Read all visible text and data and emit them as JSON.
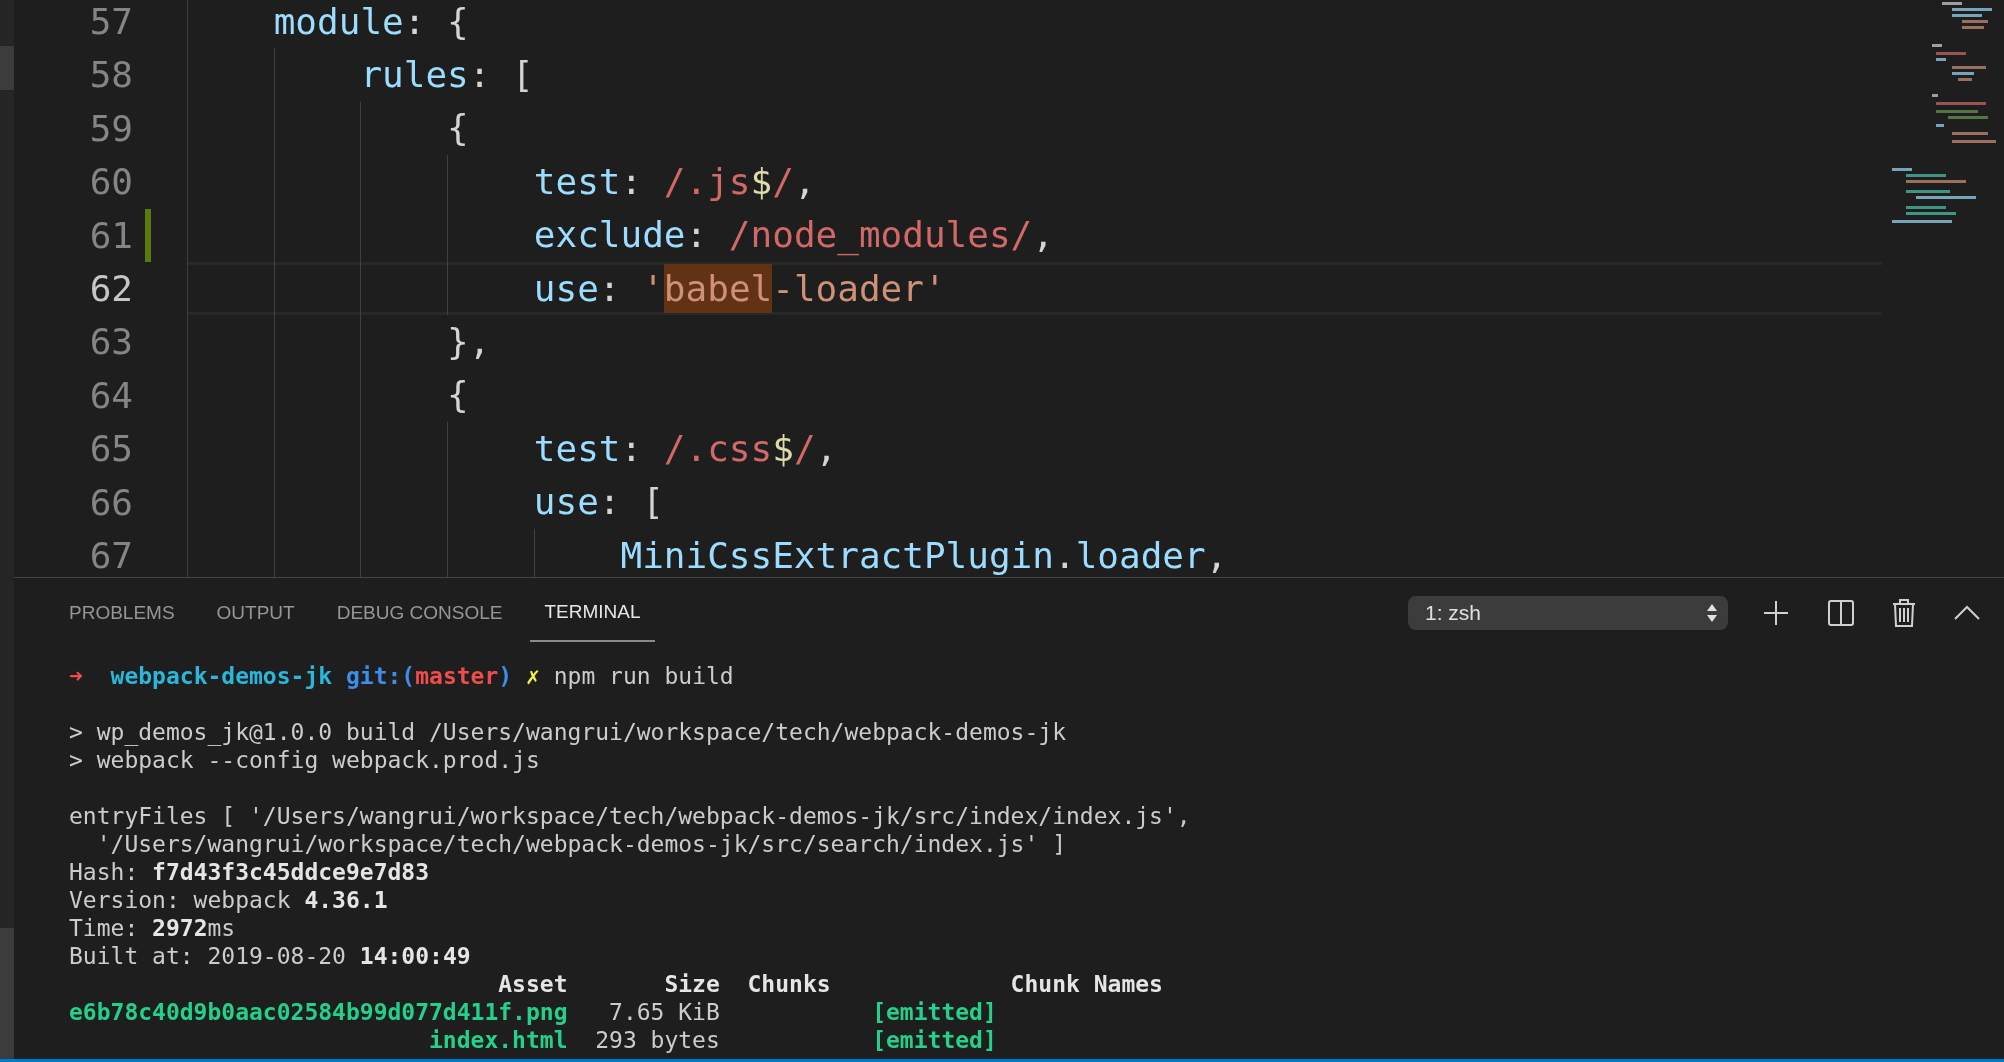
{
  "editor": {
    "lines": [
      {
        "number": "57",
        "current": false,
        "modified": false,
        "tokens": [
          {
            "text": "    module",
            "kind": "key"
          },
          {
            "text": ": {",
            "kind": "punct"
          }
        ]
      },
      {
        "number": "58",
        "current": false,
        "modified": false,
        "tokens": [
          {
            "text": "        rules",
            "kind": "key"
          },
          {
            "text": ": [",
            "kind": "punct"
          }
        ]
      },
      {
        "number": "59",
        "current": false,
        "modified": false,
        "tokens": [
          {
            "text": "            {",
            "kind": "punct"
          }
        ]
      },
      {
        "number": "60",
        "current": false,
        "modified": false,
        "tokens": [
          {
            "text": "                test",
            "kind": "key"
          },
          {
            "text": ": ",
            "kind": "punct"
          },
          {
            "text": "/.js",
            "kind": "regex"
          },
          {
            "text": "$",
            "kind": "dollar"
          },
          {
            "text": "/",
            "kind": "regex"
          },
          {
            "text": ",",
            "kind": "punct"
          }
        ]
      },
      {
        "number": "61",
        "current": false,
        "modified": true,
        "tokens": [
          {
            "text": "                exclude",
            "kind": "key"
          },
          {
            "text": ": ",
            "kind": "punct"
          },
          {
            "text": "/node_modules/",
            "kind": "regex"
          },
          {
            "text": ",",
            "kind": "punct"
          }
        ]
      },
      {
        "number": "62",
        "current": true,
        "modified": false,
        "tokens": [
          {
            "text": "                use",
            "kind": "key"
          },
          {
            "text": ": ",
            "kind": "punct"
          },
          {
            "text": "'",
            "kind": "string"
          },
          {
            "text": "babel",
            "kind": "match"
          },
          {
            "text": "-loader'",
            "kind": "string"
          }
        ]
      },
      {
        "number": "63",
        "current": false,
        "modified": false,
        "tokens": [
          {
            "text": "            },",
            "kind": "punct"
          }
        ]
      },
      {
        "number": "64",
        "current": false,
        "modified": false,
        "tokens": [
          {
            "text": "            {",
            "kind": "punct"
          }
        ]
      },
      {
        "number": "65",
        "current": false,
        "modified": false,
        "tokens": [
          {
            "text": "                test",
            "kind": "key"
          },
          {
            "text": ": ",
            "kind": "punct"
          },
          {
            "text": "/.css",
            "kind": "regex"
          },
          {
            "text": "$",
            "kind": "dollar"
          },
          {
            "text": "/",
            "kind": "regex"
          },
          {
            "text": ",",
            "kind": "punct"
          }
        ]
      },
      {
        "number": "66",
        "current": false,
        "modified": false,
        "tokens": [
          {
            "text": "                use",
            "kind": "key"
          },
          {
            "text": ": [",
            "kind": "punct"
          }
        ]
      },
      {
        "number": "67",
        "current": false,
        "modified": false,
        "tokens": [
          {
            "text": "                    MiniCssExtractPlugin",
            "kind": "key"
          },
          {
            "text": ".",
            "kind": "punct"
          },
          {
            "text": "loader",
            "kind": "key"
          },
          {
            "text": ",",
            "kind": "punct"
          }
        ]
      }
    ]
  },
  "panel": {
    "tabs": [
      {
        "label": "PROBLEMS",
        "selected": false
      },
      {
        "label": "OUTPUT",
        "selected": false
      },
      {
        "label": "DEBUG CONSOLE",
        "selected": false
      },
      {
        "label": "TERMINAL",
        "selected": true
      }
    ],
    "terminal_select": {
      "value": "1: zsh"
    },
    "terminal": {
      "blocks": [
        [
          [
            {
              "text": "➜ ",
              "kind": "arrow"
            },
            {
              "text": " webpack-demos-jk",
              "kind": "dir"
            },
            {
              "text": " git:(",
              "kind": "git"
            },
            {
              "text": "master",
              "kind": "branch"
            },
            {
              "text": ")",
              "kind": "git"
            },
            {
              "text": " ✗",
              "kind": "dirty"
            },
            {
              "text": " npm run build",
              "kind": "plain"
            }
          ]
        ],
        [
          [
            {
              "text": "> wp_demos_jk@1.0.0 build /Users/wangrui/workspace/tech/webpack-demos-jk",
              "kind": "plain"
            }
          ],
          [
            {
              "text": "> webpack --config webpack.prod.js",
              "kind": "plain"
            }
          ]
        ],
        [
          [
            {
              "text": "entryFiles [ '/Users/wangrui/workspace/tech/webpack-demos-jk/src/index/index.js',",
              "kind": "plain"
            }
          ],
          [
            {
              "text": "  '/Users/wangrui/workspace/tech/webpack-demos-jk/src/search/index.js' ]",
              "kind": "plain"
            }
          ],
          [
            {
              "text": "Hash: ",
              "kind": "plain"
            },
            {
              "text": "f7d43f3c45ddce9e7d83",
              "kind": "bold"
            }
          ],
          [
            {
              "text": "Version: webpack ",
              "kind": "plain"
            },
            {
              "text": "4.36.1",
              "kind": "bold"
            }
          ],
          [
            {
              "text": "Time: ",
              "kind": "plain"
            },
            {
              "text": "2972",
              "kind": "bold"
            },
            {
              "text": "ms",
              "kind": "plain"
            }
          ],
          [
            {
              "text": "Built at: 2019-08-20 ",
              "kind": "plain"
            },
            {
              "text": "14:00:49",
              "kind": "bold"
            }
          ],
          [
            {
              "text": "                               Asset       Size  Chunks             Chunk Names",
              "kind": "bold"
            }
          ],
          [
            {
              "text": "e6b78c40d9b0aac02584b99d077d411f.png",
              "kind": "asset"
            },
            {
              "text": "   7.65 KiB           ",
              "kind": "plain"
            },
            {
              "text": "[emitted]",
              "kind": "emitted"
            }
          ],
          [
            {
              "text": "                          index.html",
              "kind": "asset"
            },
            {
              "text": "  293 bytes           ",
              "kind": "plain"
            },
            {
              "text": "[emitted]",
              "kind": "emitted"
            }
          ]
        ]
      ]
    }
  }
}
